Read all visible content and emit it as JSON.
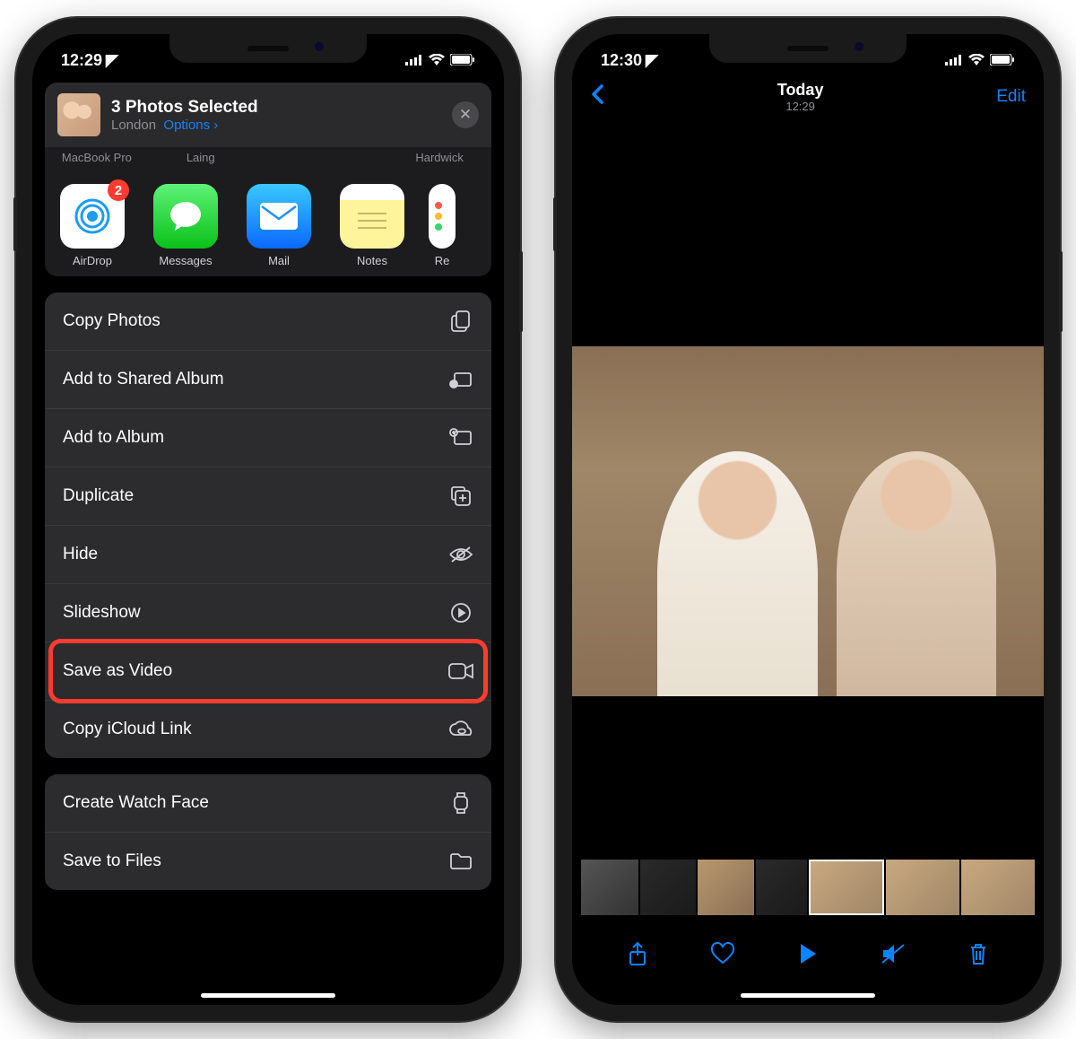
{
  "phoneA": {
    "status": {
      "time": "12:29"
    },
    "sheet": {
      "title": "3 Photos Selected",
      "location": "London",
      "options_label": "Options",
      "airdrop_targets": [
        "MacBook Pro",
        "Laing",
        "Hardwick"
      ],
      "apps": [
        {
          "label": "AirDrop",
          "badge": "2"
        },
        {
          "label": "Messages"
        },
        {
          "label": "Mail"
        },
        {
          "label": "Notes"
        },
        {
          "label": "Re"
        }
      ],
      "actions_group1": [
        {
          "label": "Copy Photos",
          "icon": "copy"
        },
        {
          "label": "Add to Shared Album",
          "icon": "shared-album"
        },
        {
          "label": "Add to Album",
          "icon": "album-add"
        },
        {
          "label": "Duplicate",
          "icon": "duplicate"
        },
        {
          "label": "Hide",
          "icon": "hide"
        },
        {
          "label": "Slideshow",
          "icon": "play-circle"
        },
        {
          "label": "Save as Video",
          "icon": "video",
          "highlighted": true
        },
        {
          "label": "Copy iCloud Link",
          "icon": "cloud-link"
        }
      ],
      "actions_group2": [
        {
          "label": "Create Watch Face",
          "icon": "watch"
        },
        {
          "label": "Save to Files",
          "icon": "folder"
        }
      ]
    }
  },
  "phoneB": {
    "status": {
      "time": "12:30"
    },
    "nav": {
      "title": "Today",
      "subtitle": "12:29",
      "edit_label": "Edit"
    }
  },
  "colors": {
    "ios_blue": "#0a84ff",
    "highlight_red": "#ff3b30"
  }
}
